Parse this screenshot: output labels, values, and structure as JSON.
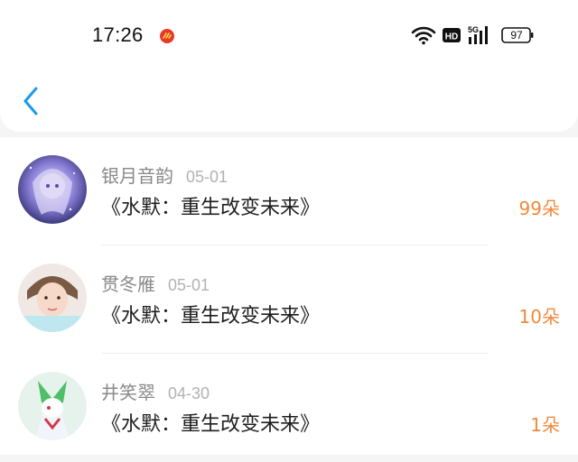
{
  "status_bar": {
    "time": "17:26",
    "battery": "97",
    "network": "5G",
    "hd_label": "HD"
  },
  "nav": {
    "back_icon": "chevron-left-icon"
  },
  "colors": {
    "accent": "#1a9bea",
    "count": "#f08a3c",
    "name": "#8a8a8a",
    "date": "#b2b2b2"
  },
  "gifts": [
    {
      "name": "银月音韵",
      "date": "05-01",
      "book": "《水默：重生改变未来》",
      "count": "99朵"
    },
    {
      "name": "贯冬雁",
      "date": "05-01",
      "book": "《水默：重生改变未来》",
      "count": "10朵"
    },
    {
      "name": "井笑翠",
      "date": "04-30",
      "book": "《水默：重生改变未来》",
      "count": "1朵"
    }
  ]
}
